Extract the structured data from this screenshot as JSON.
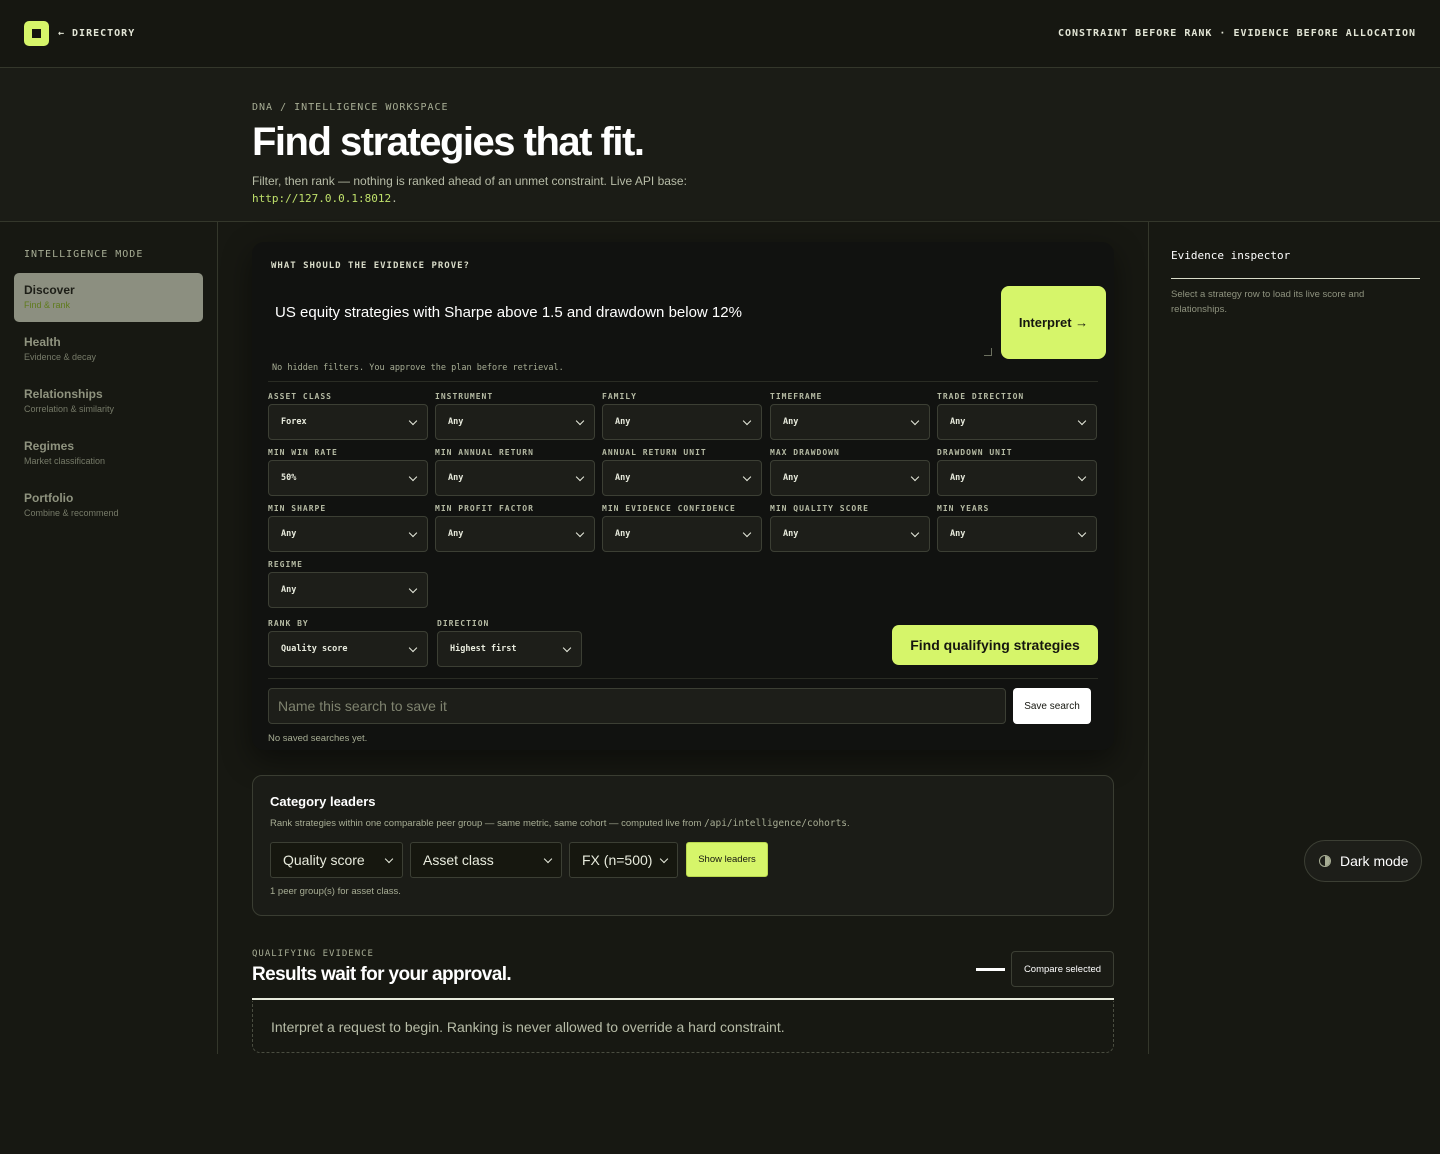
{
  "topbar": {
    "directory_link": "← DIRECTORY",
    "tagline": "CONSTRAINT BEFORE RANK · EVIDENCE BEFORE ALLOCATION"
  },
  "hero": {
    "breadcrumb": "DNA / INTELLIGENCE WORKSPACE",
    "title": "Find strategies that fit.",
    "subtitle": "Filter, then rank — nothing is ranked ahead of an unmet constraint. Live API base:",
    "api_base": "http://127.0.0.1:8012",
    "api_suffix": "."
  },
  "sidebar": {
    "heading": "INTELLIGENCE MODE",
    "items": [
      {
        "label": "Discover",
        "sub": "Find & rank"
      },
      {
        "label": "Health",
        "sub": "Evidence & decay"
      },
      {
        "label": "Relationships",
        "sub": "Correlation & similarity"
      },
      {
        "label": "Regimes",
        "sub": "Market classification"
      },
      {
        "label": "Portfolio",
        "sub": "Combine & recommend"
      }
    ]
  },
  "query": {
    "label": "WHAT SHOULD THE EVIDENCE PROVE?",
    "value": "US equity strategies with Sharpe above 1.5 and drawdown below 12%",
    "interpret_label": "Interpret →",
    "note": "No hidden filters. You approve the plan before retrieval."
  },
  "filters": [
    {
      "label": "ASSET CLASS",
      "value": "Forex"
    },
    {
      "label": "INSTRUMENT",
      "value": "Any"
    },
    {
      "label": "FAMILY",
      "value": "Any"
    },
    {
      "label": "TIMEFRAME",
      "value": "Any"
    },
    {
      "label": "TRADE DIRECTION",
      "value": "Any"
    },
    {
      "label": "MIN WIN RATE",
      "value": "50%"
    },
    {
      "label": "MIN ANNUAL RETURN",
      "value": "Any"
    },
    {
      "label": "ANNUAL RETURN UNIT",
      "value": "Any"
    },
    {
      "label": "MAX DRAWDOWN",
      "value": "Any"
    },
    {
      "label": "DRAWDOWN UNIT",
      "value": "Any"
    },
    {
      "label": "MIN SHARPE",
      "value": "Any"
    },
    {
      "label": "MIN PROFIT FACTOR",
      "value": "Any"
    },
    {
      "label": "MIN EVIDENCE CONFIDENCE",
      "value": "Any"
    },
    {
      "label": "MIN QUALITY SCORE",
      "value": "Any"
    },
    {
      "label": "MIN YEARS",
      "value": "Any"
    },
    {
      "label": "REGIME",
      "value": "Any"
    }
  ],
  "ranking": {
    "rank_by_label": "RANK BY",
    "rank_by_value": "Quality score",
    "direction_label": "DIRECTION",
    "direction_value": "Highest first",
    "find_label": "Find qualifying strategies"
  },
  "saved": {
    "placeholder": "Name this search to save it",
    "save_label": "Save search",
    "empty_note": "No saved searches yet."
  },
  "leaders": {
    "title": "Category leaders",
    "subtitle": "Rank strategies within one comparable peer group — same metric, same cohort — computed live from",
    "endpoint": "/api/intelligence/cohorts",
    "subtitle_end": ".",
    "metric": "Quality score",
    "group_by": "Asset class",
    "cohort": "FX (n=500)",
    "show_label": "Show leaders",
    "note": "1 peer group(s) for asset class."
  },
  "results": {
    "eyebrow": "QUALIFYING EVIDENCE",
    "title": "Results wait for your approval.",
    "compare_label": "Compare selected",
    "empty": "Interpret a request to begin. Ranking is never allowed to override a hard constraint."
  },
  "inspector": {
    "title": "Evidence inspector",
    "text": "Select a strategy row to load its live score and relationships."
  },
  "theme_toggle": {
    "label": "Dark mode"
  },
  "colors": {
    "accent": "#d6f56a",
    "background": "#171812"
  }
}
